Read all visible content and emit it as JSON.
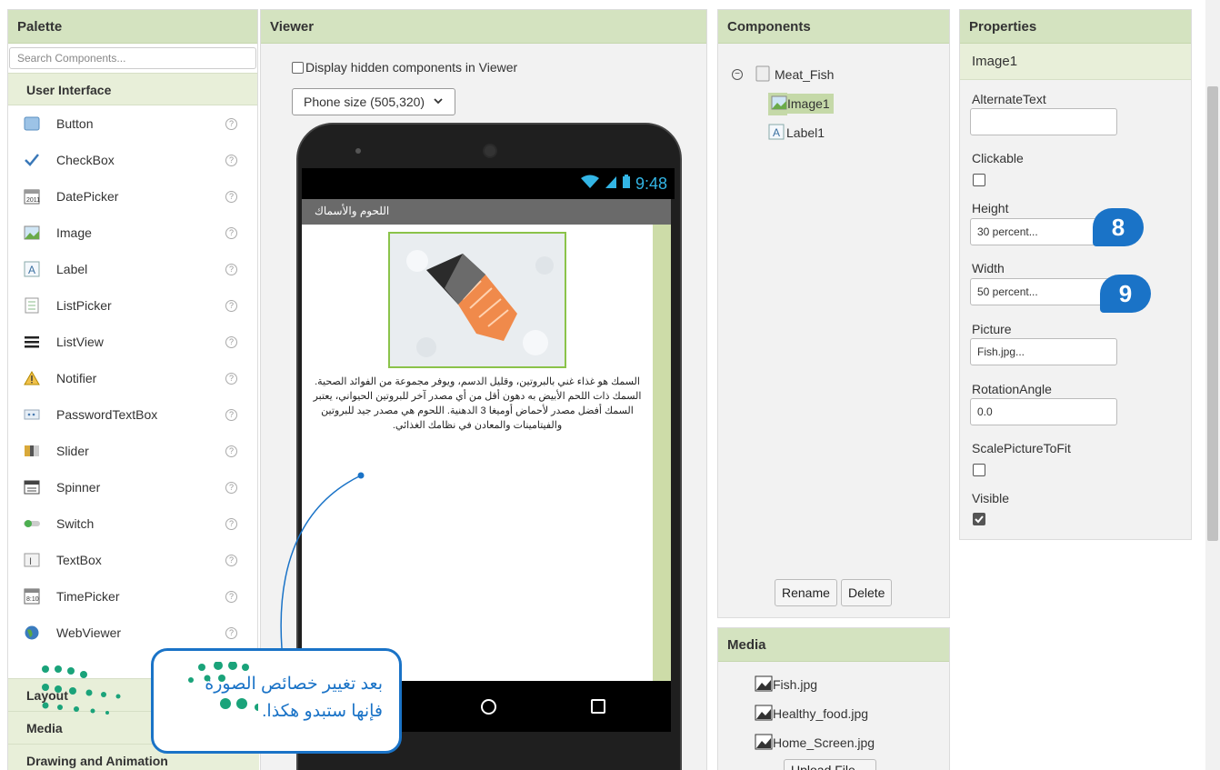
{
  "palette": {
    "header": "Palette",
    "search_placeholder": "Search Components...",
    "section_ui": "User Interface",
    "items": [
      {
        "label": "Button",
        "icon": "button-icon"
      },
      {
        "label": "CheckBox",
        "icon": "checkbox-icon"
      },
      {
        "label": "DatePicker",
        "icon": "calendar-icon"
      },
      {
        "label": "Image",
        "icon": "image-icon"
      },
      {
        "label": "Label",
        "icon": "label-icon"
      },
      {
        "label": "ListPicker",
        "icon": "list-picker-icon"
      },
      {
        "label": "ListView",
        "icon": "list-view-icon"
      },
      {
        "label": "Notifier",
        "icon": "warning-icon"
      },
      {
        "label": "PasswordTextBox",
        "icon": "password-icon"
      },
      {
        "label": "Slider",
        "icon": "slider-icon"
      },
      {
        "label": "Spinner",
        "icon": "spinner-icon"
      },
      {
        "label": "Switch",
        "icon": "switch-icon"
      },
      {
        "label": "TextBox",
        "icon": "textbox-icon"
      },
      {
        "label": "TimePicker",
        "icon": "time-picker-icon"
      },
      {
        "label": "WebViewer",
        "icon": "globe-icon"
      }
    ],
    "help_glyph": "?",
    "sections_below": [
      "Layout",
      "Media",
      "Drawing and Animation"
    ]
  },
  "viewer": {
    "header": "Viewer",
    "hidden_components_label": "Display hidden components in Viewer",
    "size_select_value": "Phone size (505,320)",
    "phone": {
      "time": "9:48",
      "screen_title": "اللحوم والأسماك",
      "body_text": "السمك هو غذاء غني بالبروتين، وقليل الدسم، ويوفر مجموعة من الفوائد الصحية. السمك ذات اللحم الأبيض به دهون أقل من أي مصدر آخر للبروتين الحيواني، يعتبر السمك أفضل مصدر لأحماض أوميغا 3 الدهنية. اللحوم هي مصدر جيد للبروتين والفيتامينات والمعادن في نظامك الغذائي."
    }
  },
  "components": {
    "header": "Components",
    "tree": [
      {
        "label": "Meat_Fish",
        "level": 0
      },
      {
        "label": "Image1",
        "level": 1,
        "selected": true
      },
      {
        "label": "Label1",
        "level": 1
      }
    ],
    "rename_label": "Rename",
    "delete_label": "Delete"
  },
  "media": {
    "header": "Media",
    "files": [
      "Fish.jpg",
      "Healthy_food.jpg",
      "Home_Screen.jpg"
    ],
    "upload_label": "Upload File ..."
  },
  "properties": {
    "header": "Properties",
    "component": "Image1",
    "alternate_text_label": "AlternateText",
    "alternate_text_value": "",
    "clickable_label": "Clickable",
    "clickable": false,
    "height_label": "Height",
    "height_value": "30 percent...",
    "width_label": "Width",
    "width_value": "50 percent...",
    "picture_label": "Picture",
    "picture_value": "Fish.jpg...",
    "rotation_label": "RotationAngle",
    "rotation_value": "0.0",
    "scale_label": "ScalePictureToFit",
    "scale": false,
    "visible_label": "Visible",
    "visible": true
  },
  "annotations": {
    "badge_height": "8",
    "badge_width": "9",
    "callout_text": "بعد تغيير خصائص الصورة فإنها ستبدو هكذا."
  },
  "colors": {
    "header_green": "#d4e3c0",
    "accent_blue": "#1a73c7",
    "phone_status": "#33b5e5"
  }
}
